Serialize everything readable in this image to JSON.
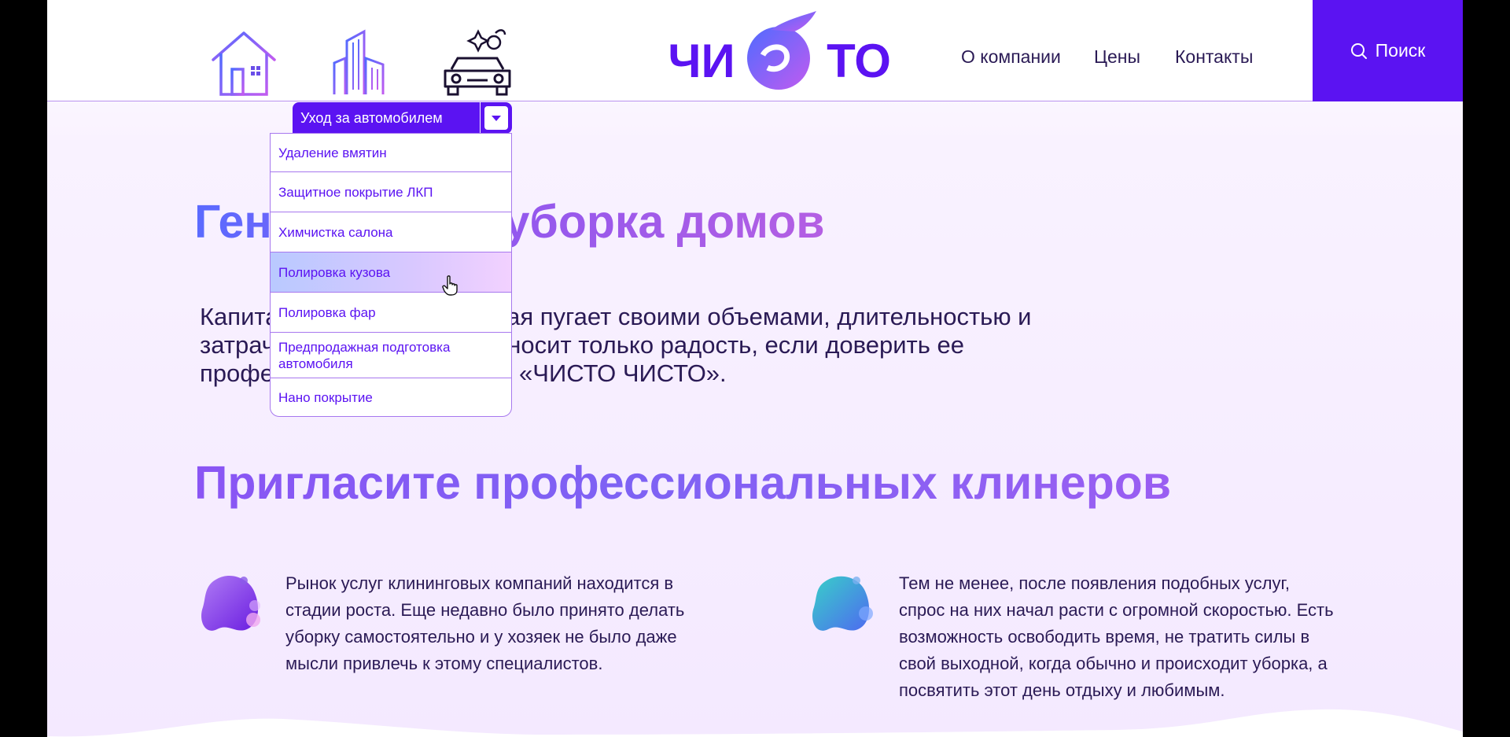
{
  "header": {
    "nav": [
      "О компании",
      "Цены",
      "Контакты"
    ],
    "search_label": "Поиск",
    "logo_text": "ЧИСТО"
  },
  "categories": [
    "home-icon",
    "building-icon",
    "car-icon"
  ],
  "dropdown": {
    "selected": "Уход за автомобилем",
    "items": [
      "Удаление вмятин",
      "Защитное покрытие ЛКП",
      "Химчистка салона",
      "Полировка кузова",
      "Полировка фар",
      "Предпродажная подготовка автомобиля",
      "Нано покрытие"
    ],
    "active_index": 3
  },
  "hero": {
    "title": "Генеральная уборка домов",
    "text": "Капитальная уборка, которая пугает своими объемами, длительностью и затраченными силами, приносит только радость, если доверить ее профессионалам компании «ЧИСТО ЧИСТО»."
  },
  "section": {
    "title": "Пригласите профессиональных клинеров",
    "col1": "Рынок услуг клининговых компаний находится в стадии роста. Еще недавно было принято делать уборку самостоятельно и у хозяек не было даже мысли привлечь к этому специалистов.",
    "col2": "Тем не менее, после появления подобных услуг, спрос на них начал расти с огромной скоростью. Есть возможность освободить время, не тратить силы в свой выходной, когда обычно и происходит уборка, а посвятить этот день отдыху и любимым."
  },
  "colors": {
    "primary": "#5b13f2",
    "text": "#2a1a55",
    "border": "#a778ee"
  }
}
